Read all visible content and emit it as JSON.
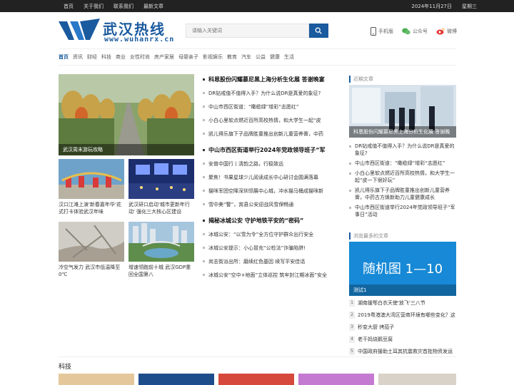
{
  "topbar": {
    "links": [
      "首页",
      "关于我们",
      "联系我们",
      "最新文章"
    ],
    "date": "2024年11月27日",
    "weekday": "星期三"
  },
  "logo": {
    "cn": "武汉热线",
    "en": "www.wuhanrx.cn"
  },
  "search": {
    "placeholder": "请输入关键词"
  },
  "header_links": [
    {
      "icon": "mobile-icon",
      "label": "手机版"
    },
    {
      "icon": "wechat-icon",
      "label": "公众号"
    },
    {
      "icon": "weibo-icon",
      "label": "微博"
    }
  ],
  "nav": [
    "首页",
    "资讯",
    "财经",
    "科技",
    "商业",
    "女性时尚",
    "房产家居",
    "母婴亲子",
    "影视娱乐",
    "教育",
    "汽车",
    "公益",
    "健康",
    "生活"
  ],
  "left": {
    "big_caption": "武汉周末游玩攻略",
    "tiles": [
      {
        "caption": "汉口江滩上演'新春嘉年华'花式打卡体验武汉年味"
      },
      {
        "caption": "武汉研口启动'城市更新年行动' 强化三大核心区建设"
      },
      {
        "caption": "冷空气发力 武汉市低温降至0℃"
      },
      {
        "caption": "增速领跑前十城 武汉GDP重回全国第八"
      }
    ]
  },
  "middle": {
    "groups": [
      {
        "headline": "科恩股份闪耀慕尼黑上海分析生化展 答谢晚宴",
        "items": [
          "DR钻戒值不值得入手？为什么说DR是真爱的象征?",
          "中山市西区街道：“橄榄绿”增彩“志愿红”",
          "小白心里软点燃近百所高校热情，和大学生一起“皮",
          "凯儿得乐旗下子品牌胜童推出创新儿童营养膏，中药"
        ]
      },
      {
        "headline": "中山市西区街道举行2024年党政领导班子“军",
        "items": [
          "安普中国行丨清韵之路，行稳致远",
          "聚焦！书果星球少儿阅读成长中心研讨会圆满落幕",
          "猫咪军团空降深圳领展中心城，冲水猫马桶成猫咪新",
          "雪中美“警”，宾县公安迎战风雪保畅通"
        ]
      },
      {
        "headline": "揭秘冰城公安 守护地铁平安的“密码”",
        "items": [
          "冰城公安：“以雪为令”全方位守护群众出行安全",
          "冰城公安提示：小心冒充“公检法”诈骗陷阱!",
          "尚志街派出所：磨续红色基因 续写平安佳话",
          "冰城公安“空中+地面”立体巡控 筑牢封江期冰面”安全"
        ]
      }
    ]
  },
  "right": {
    "recent_title": "近期文章",
    "feature_caption": "科恩股份闪耀慕尼黑上海分析生化展 答谢晚",
    "recent_items": [
      "DR钻戒值不值得入手？为什么说DR是真爱的象征?",
      "中山市西区街道：“橄榄绿”增彩“志愿红”",
      "小白心里软点燃近百所高校热情，和大学生一起“皮一下很好玩”",
      "凯儿得乐旗下子品牌胜童推出创新儿童营养膏，中药古方焕新助力儿童健康成长",
      "中山市西区街道举行2024年党政领导班子“军事日”活动"
    ],
    "popular_title": "浏览最多的文章",
    "random_text": "随机图 1—10",
    "random_caption": "测试1",
    "popular_items": [
      "湖南援鄂白衣天使'放飞'三八节",
      "2019粤港澳大湾区营商环境有哪些变化？这",
      "秒变大厨 烤茄子",
      "老干妈烧鹅豆腐",
      "中国政府援助土耳其抗震救灾首批物资发运"
    ],
    "accent": "#1a5a9e"
  },
  "science": {
    "title": "科技"
  }
}
